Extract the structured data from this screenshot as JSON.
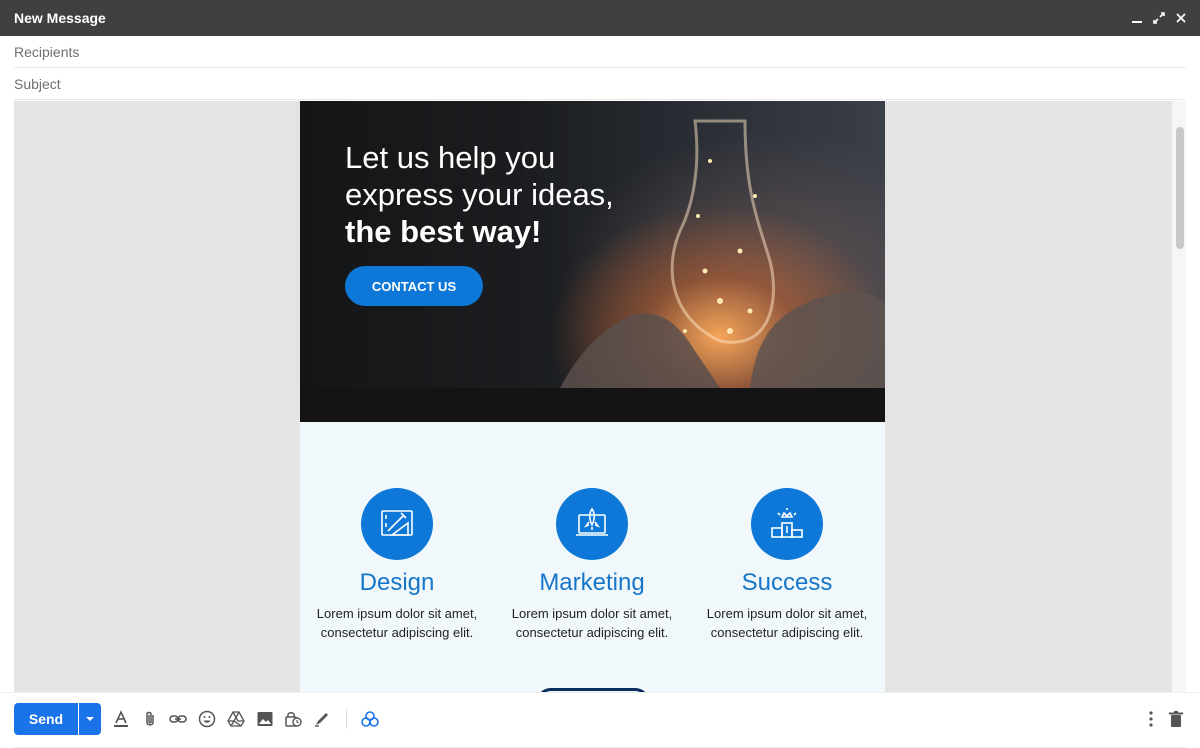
{
  "window": {
    "title": "New Message",
    "controls": [
      "minimize-icon",
      "expand-icon",
      "close-icon"
    ]
  },
  "fields": {
    "recipients_placeholder": "Recipients",
    "subject_placeholder": "Subject"
  },
  "email": {
    "hero": {
      "line1": "Let us help you",
      "line2": "express your ideas,",
      "line3": "the best way!",
      "cta_label": "CONTACT US"
    },
    "features": [
      {
        "title": "Design",
        "icon": "design-tools-icon",
        "text": "Lorem ipsum dolor sit amet, consectetur adipiscing elit."
      },
      {
        "title": "Marketing",
        "icon": "rocket-laptop-icon",
        "text": "Lorem ipsum dolor sit amet, consectetur adipiscing elit."
      },
      {
        "title": "Success",
        "icon": "podium-icon",
        "text": "Lorem ipsum dolor sit amet, consectetur adipiscing elit."
      }
    ]
  },
  "toolbar": {
    "send_label": "Send",
    "tools": [
      "formatting-options-icon",
      "attach-files-icon",
      "insert-link-icon",
      "insert-emoji-icon",
      "drive-icon",
      "insert-photo-icon",
      "confidential-mode-icon",
      "signature-icon",
      "addon-icon"
    ],
    "right_tools": [
      "more-options-icon",
      "discard-draft-icon"
    ]
  },
  "colors": {
    "titlebar": "#404040",
    "accent": "#0d78d8",
    "send": "#1a73e8",
    "feature_title": "#1676c9"
  }
}
